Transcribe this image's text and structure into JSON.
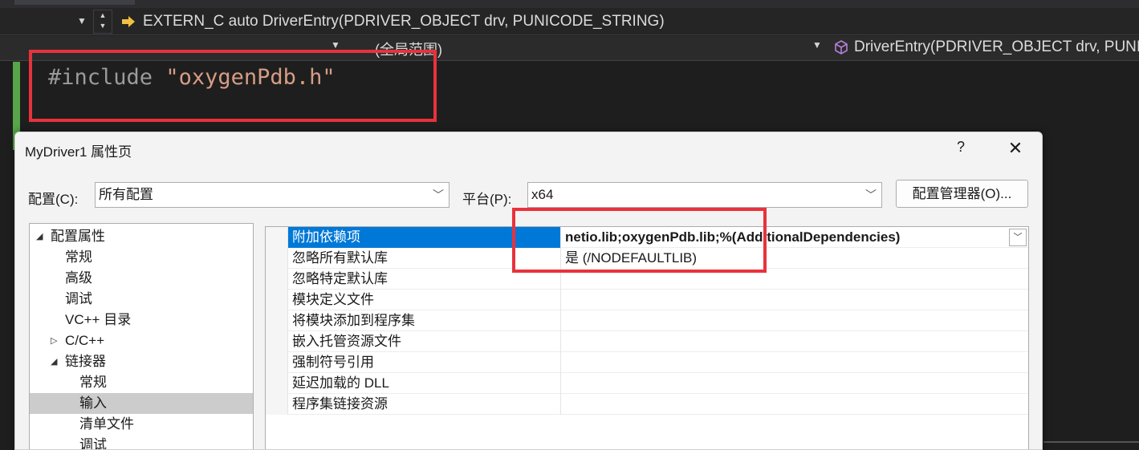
{
  "editor": {
    "function_nav": "EXTERN_C auto DriverEntry(PDRIVER_OBJECT drv, PUNICODE_STRING)",
    "scope": "(全局范围)",
    "member_nav": "DriverEntry(PDRIVER_OBJECT drv, PUNICO",
    "code": {
      "directive": "#include ",
      "header": "\"oxygenPdb.h\""
    }
  },
  "dialog": {
    "title": "MyDriver1 属性页",
    "help": "?",
    "close": "✕",
    "config_label": "配置(C):",
    "config_value": "所有配置",
    "platform_label": "平台(P):",
    "platform_value": "x64",
    "config_manager_button": "配置管理器(O)...",
    "tree": [
      {
        "label": "配置属性",
        "twisty": "◢",
        "level": 0
      },
      {
        "label": "常规",
        "level": 1
      },
      {
        "label": "高级",
        "level": 1
      },
      {
        "label": "调试",
        "level": 1
      },
      {
        "label": "VC++ 目录",
        "level": 1
      },
      {
        "label": "C/C++",
        "twisty": "▷",
        "level": 1
      },
      {
        "label": "链接器",
        "twisty": "◢",
        "level": 1
      },
      {
        "label": "常规",
        "level": 2
      },
      {
        "label": "输入",
        "level": 2,
        "selected": true
      },
      {
        "label": "清单文件",
        "level": 2
      },
      {
        "label": "调试",
        "level": 2
      }
    ],
    "properties": [
      {
        "name": "附加依赖项",
        "value": "netio.lib;oxygenPdb.lib;%(AdditionalDependencies)",
        "bold": true,
        "selected": true
      },
      {
        "name": "忽略所有默认库",
        "value": "是 (/NODEFAULTLIB)"
      },
      {
        "name": "忽略特定默认库",
        "value": ""
      },
      {
        "name": "模块定义文件",
        "value": ""
      },
      {
        "name": "将模块添加到程序集",
        "value": ""
      },
      {
        "name": "嵌入托管资源文件",
        "value": ""
      },
      {
        "name": "强制符号引用",
        "value": ""
      },
      {
        "name": "延迟加载的 DLL",
        "value": ""
      },
      {
        "name": "程序集链接资源",
        "value": ""
      }
    ]
  }
}
